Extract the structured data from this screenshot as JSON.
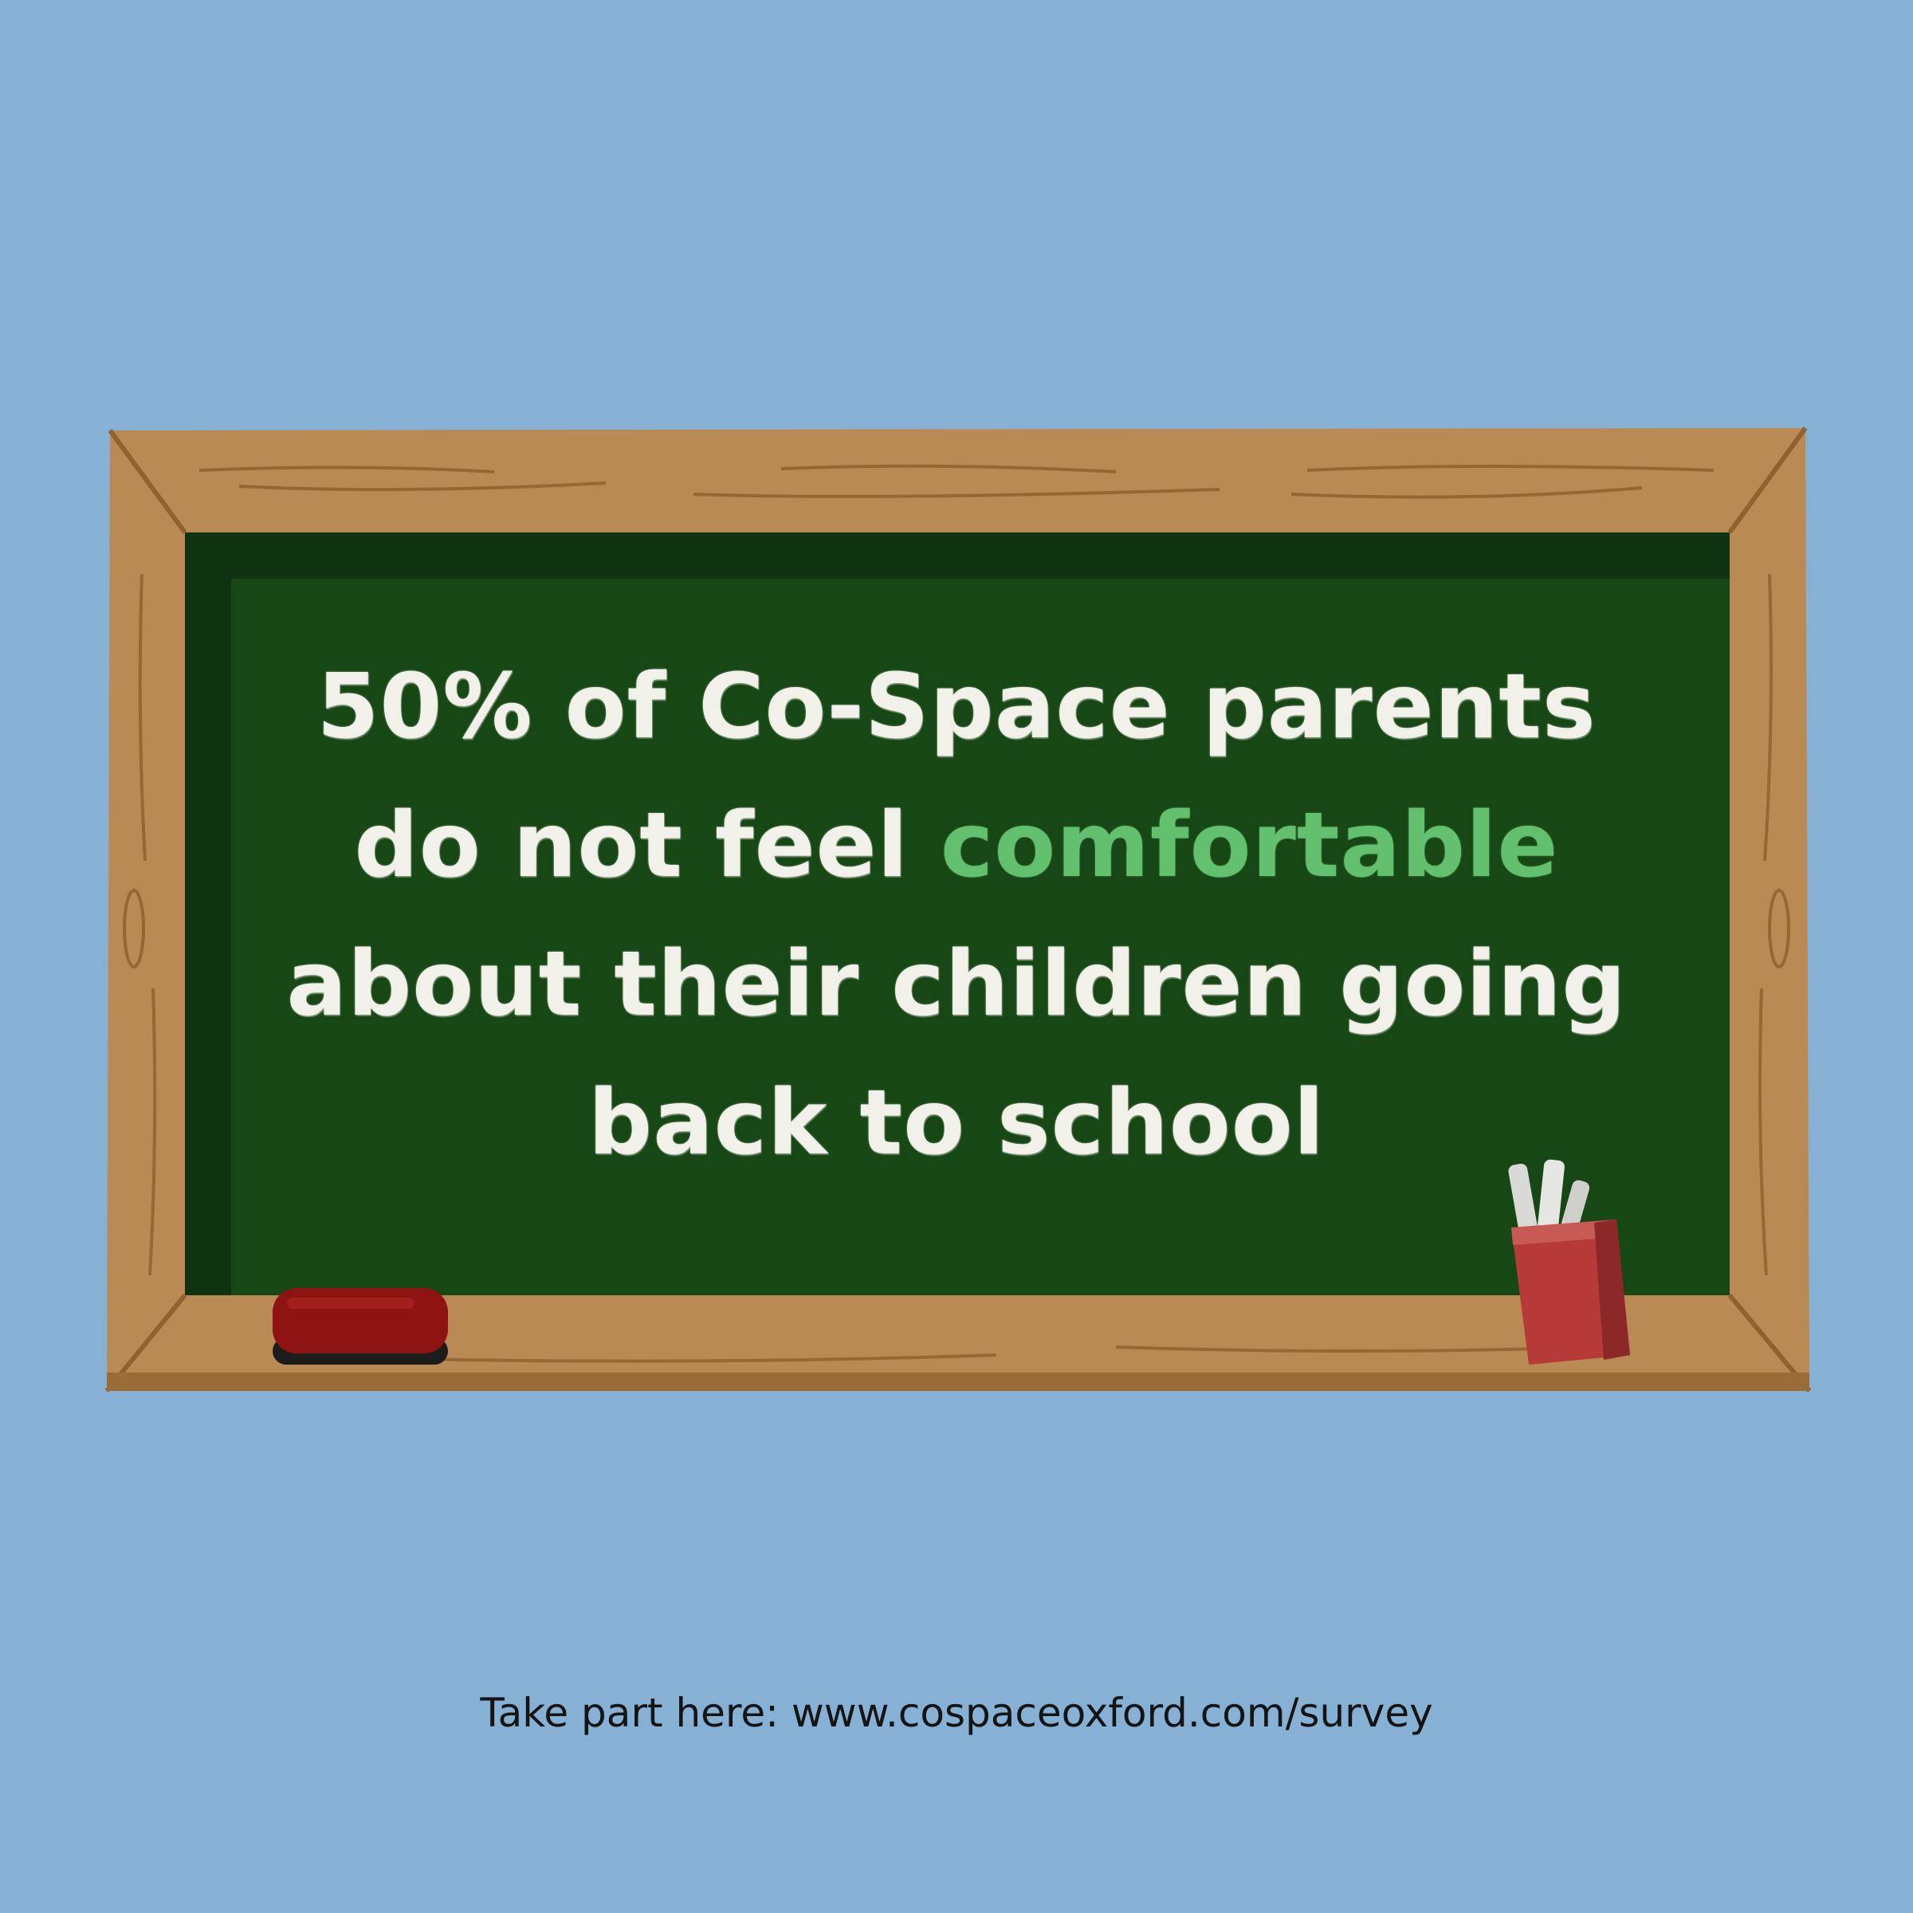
{
  "message": {
    "line1": "50% of Co-Space parents",
    "line2_prefix": "do not feel ",
    "line2_highlight": "comfortable",
    "line3": "about their children going",
    "line4": "back to school"
  },
  "footer": {
    "text": "Take part here: www.cospaceoxford.com/survey"
  },
  "colors": {
    "background": "#86b1d5",
    "frame": "#b98a53",
    "board": "#174714",
    "chalk": "#f1f1ea",
    "highlight": "#63c06e",
    "eraser": "#8e1413",
    "cup": "#b63a37"
  },
  "icons": {
    "eraser": "eraser-icon",
    "chalk_cup": "chalk-cup-icon"
  }
}
